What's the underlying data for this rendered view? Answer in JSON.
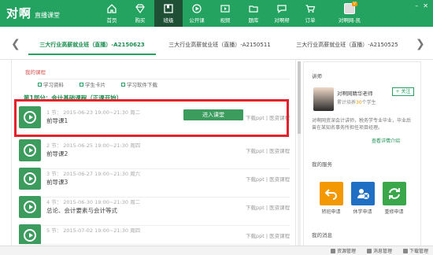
{
  "brand": {
    "logo": "对啊",
    "sub": "直播课堂"
  },
  "nav": [
    {
      "label": "首页",
      "icon": "home-icon"
    },
    {
      "label": "购买",
      "icon": "diamond-icon"
    },
    {
      "label": "班级",
      "icon": "class-icon",
      "active": true
    },
    {
      "label": "公开课",
      "icon": "broadcast-icon"
    },
    {
      "label": "视频",
      "icon": "video-icon"
    },
    {
      "label": "题库",
      "icon": "folder-icon"
    },
    {
      "label": "对啊帮",
      "icon": "chat-icon"
    },
    {
      "label": "订单",
      "icon": "cart-icon"
    }
  ],
  "user": {
    "name": "对啊网-凯",
    "badge": "V"
  },
  "class_tabs": [
    "三大行业高薪就业班（直播）-A2150623",
    "三大行业高薪就业班（直播）-A2150511",
    "三大行业高薪就业班（直播）-A2150525"
  ],
  "subtabs": [
    "我的课程"
  ],
  "links": [
    "学习资料",
    "学生卡片",
    "学习软件下载"
  ],
  "section_title": "第1部分：会计基础课程（正课开始）",
  "enter_button": "进入课堂",
  "lessons": [
    {
      "meta": "1 节：  2015-06-23 19:00~21:30  周二",
      "name": "前导课1",
      "dl": "下载ppt  |  医资课程"
    },
    {
      "meta": "2 节：  2015-06-25 19:00~21:30  周四",
      "name": "前导课2",
      "dl": "下载ppt  |  医资课程"
    },
    {
      "meta": "3 节：  2015-06-27 19:00~21:30  周六",
      "name": "前导课3",
      "dl": "下载ppt  |  医资课程"
    },
    {
      "meta": "4 节：  2015-06-30 19:00~21:30  周二",
      "name": "总论、会计要素与会计等式",
      "dl": "下载ppt  |  医资课程"
    },
    {
      "meta": "5 节：  2015-07-02 19:00~21:30  周四",
      "name": "",
      "dl": "下载ppt  |  医资课程"
    }
  ],
  "side": {
    "tutor_title": "讲师",
    "tutor_name": "对啊网睛华老师",
    "tutor_stat_prefix": "累计培养",
    "tutor_stat_count": "30",
    "tutor_stat_suffix": "个学生",
    "follow": "+ 关注",
    "tutor_desc": "对啊网资深会计讲师，税务学专业毕业，毕业后曾在某知名事务所担任项目经理。",
    "tutor_link": "查看详情介绍",
    "services_title": "我的服务",
    "services": [
      {
        "label": "转班申请",
        "color": "#f39800",
        "icon": "undo-icon"
      },
      {
        "label": "休学申请",
        "color": "#1f6fc5",
        "icon": "pause-user-icon"
      },
      {
        "label": "重修申请",
        "color": "#3aa84a",
        "icon": "refresh-icon"
      }
    ],
    "news_title": "我的消息"
  },
  "statusbar": [
    "资源管理",
    "消息管理",
    "下载管理"
  ]
}
